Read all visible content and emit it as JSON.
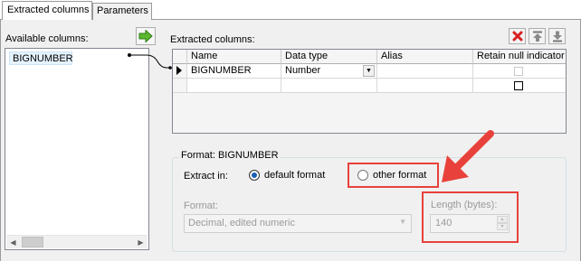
{
  "tabs": [
    {
      "label": "Extracted columns",
      "active": true
    },
    {
      "label": "Parameters",
      "active": false
    }
  ],
  "available_columns": {
    "label": "Available columns:",
    "items": [
      "BIGNUMBER"
    ]
  },
  "extracted_columns": {
    "label": "Extracted columns:",
    "headers": [
      "Name",
      "Data type",
      "Alias",
      "Retain null indicator"
    ],
    "rows": [
      {
        "name": "BIGNUMBER",
        "data_type": "Number",
        "alias": ""
      },
      {
        "name": "",
        "data_type": "",
        "alias": ""
      }
    ]
  },
  "toolbar": {
    "move_icon": "arrow-right-icon",
    "delete_icon": "red-x-icon",
    "up_icon": "move-up-icon",
    "down_icon": "move-down-icon"
  },
  "format": {
    "title": "Format: BIGNUMBER",
    "extract_in_label": "Extract in:",
    "options": [
      "default format",
      "other format"
    ],
    "selected": "default format",
    "format_label": "Format:",
    "format_value": "Decimal, edited numeric",
    "length_label": "Length (bytes):",
    "length_value": "140"
  },
  "colors": {
    "annotation": "#e8413b",
    "selection": "#e5f3ff",
    "panel": "#f0f0f0"
  }
}
